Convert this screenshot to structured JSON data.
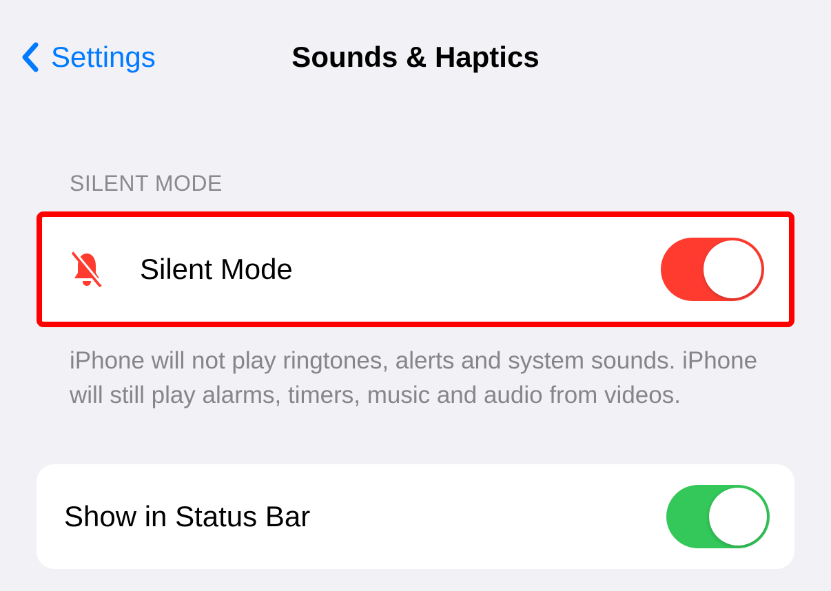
{
  "nav": {
    "back_label": "Settings",
    "title": "Sounds & Haptics"
  },
  "silent_section": {
    "header": "SILENT MODE",
    "row_label": "Silent Mode",
    "footer": "iPhone will not play ringtones, alerts and system sounds. iPhone will still play alarms, timers, music and audio from videos.",
    "toggle_on": true,
    "highlight": true
  },
  "status_bar_row": {
    "label": "Show in Status Bar",
    "toggle_on": true
  },
  "colors": {
    "accent": "#007aff",
    "toggle_red": "#ff3b30",
    "toggle_green": "#34c759",
    "highlight_border": "#ff0000"
  }
}
